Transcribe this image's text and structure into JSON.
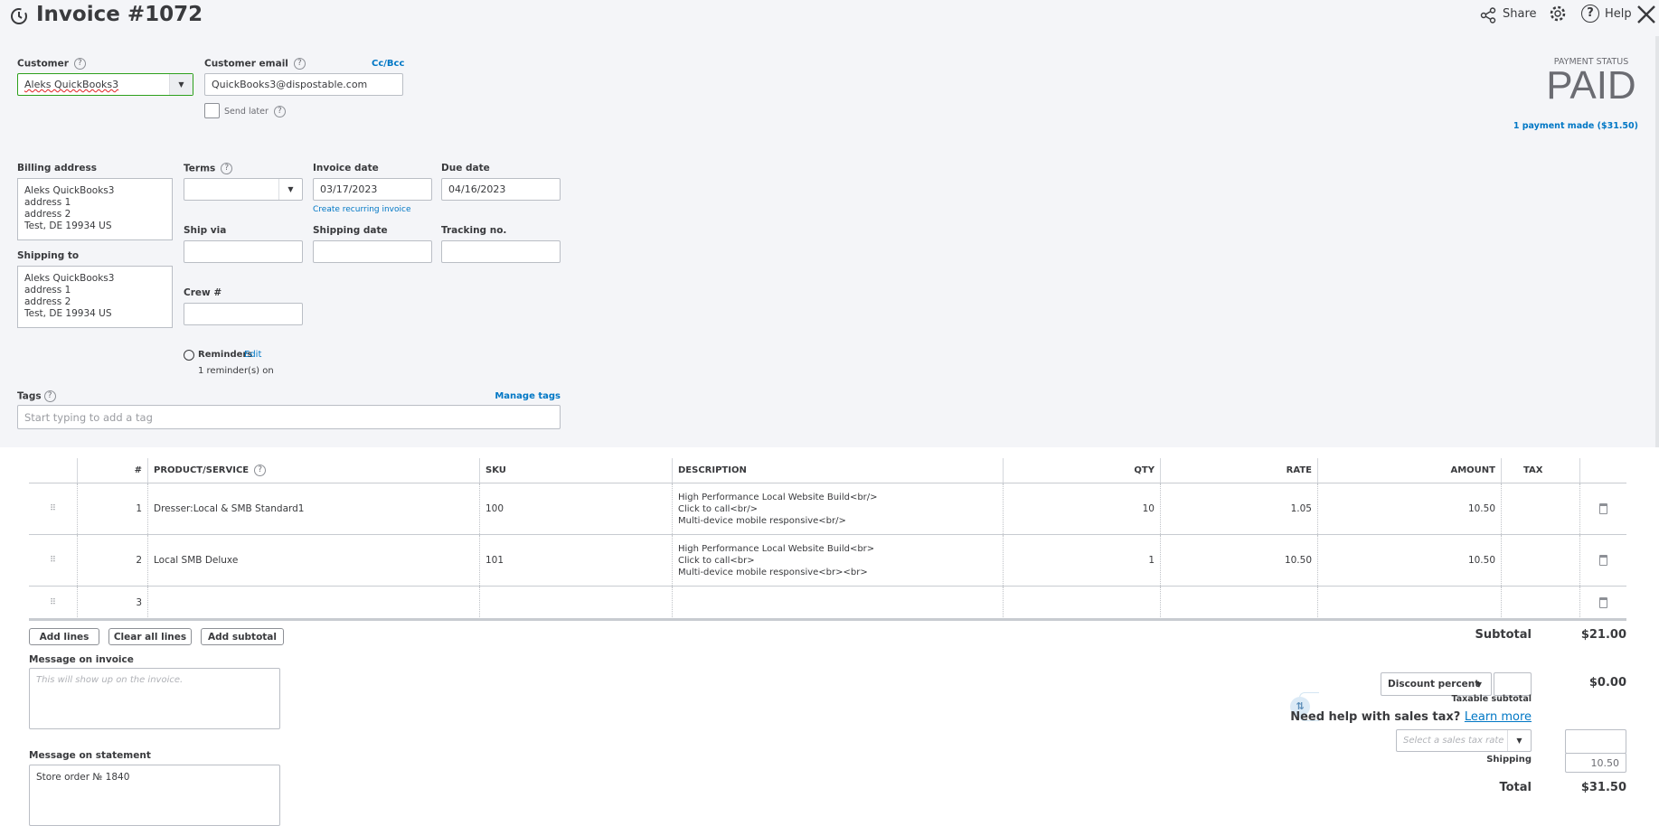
{
  "header": {
    "title": "Invoice #1072",
    "share": "Share",
    "help": "Help"
  },
  "customer": {
    "label": "Customer",
    "value": "Aleks QuickBooks3"
  },
  "email": {
    "label": "Customer email",
    "value": "QuickBooks3@dispostable.com",
    "cc_bcc": "Cc/Bcc",
    "send_later": "Send later"
  },
  "payment": {
    "label": "PAYMENT STATUS",
    "status": "PAID",
    "made": "1 payment made ($31.50)"
  },
  "billing": {
    "label": "Billing address",
    "lines": [
      "Aleks QuickBooks3",
      "address 1",
      "address 2",
      "Test, DE  19934 US"
    ]
  },
  "shipping_to": {
    "label": "Shipping to",
    "lines": [
      "Aleks QuickBooks3",
      "address 1",
      "address 2",
      "Test, DE  19934 US"
    ]
  },
  "terms": {
    "label": "Terms",
    "value": ""
  },
  "invoice_date": {
    "label": "Invoice date",
    "value": "03/17/2023",
    "recurring": "Create recurring invoice"
  },
  "due_date": {
    "label": "Due date",
    "value": "04/16/2023"
  },
  "ship_via": {
    "label": "Ship via"
  },
  "shipping_date": {
    "label": "Shipping date"
  },
  "tracking": {
    "label": "Tracking no."
  },
  "crew": {
    "label": "Crew #"
  },
  "reminders": {
    "label": "Reminders",
    "edit": "Edit",
    "status": "1 reminder(s) on"
  },
  "tags": {
    "label": "Tags",
    "manage": "Manage tags",
    "placeholder": "Start typing to add a tag"
  },
  "table": {
    "headers": [
      "#",
      "PRODUCT/SERVICE",
      "SKU",
      "DESCRIPTION",
      "QTY",
      "RATE",
      "AMOUNT",
      "TAX"
    ],
    "rows": [
      {
        "num": "1",
        "product": "Dresser:Local & SMB Standard1",
        "sku": "100",
        "description": [
          "High Performance Local Website Build<br/>",
          "Click to call<br/>",
          "Multi-device mobile responsive<br/>"
        ],
        "qty": "10",
        "rate": "1.05",
        "amount": "10.50",
        "tax": ""
      },
      {
        "num": "2",
        "product": "Local SMB Deluxe",
        "sku": "101",
        "description": [
          "High Performance Local Website Build<br>",
          "Click to call<br>",
          "Multi-device mobile responsive<br><br>"
        ],
        "qty": "1",
        "rate": "10.50",
        "amount": "10.50",
        "tax": ""
      },
      {
        "num": "3",
        "product": "",
        "sku": "",
        "description": [
          "",
          "",
          ""
        ],
        "qty": "",
        "rate": "",
        "amount": "",
        "tax": ""
      }
    ]
  },
  "buttons": {
    "add_lines": "Add lines",
    "clear_all": "Clear all lines",
    "add_subtotal": "Add subtotal"
  },
  "message_invoice": {
    "label": "Message on invoice",
    "placeholder": "This will show up on the invoice."
  },
  "message_statement": {
    "label": "Message on statement",
    "value": "Store order № 1840"
  },
  "totals": {
    "subtotal_label": "Subtotal",
    "subtotal": "$21.00",
    "discount_type": "Discount percent",
    "discount_value": "",
    "discount_amount": "$0.00",
    "taxable_subtotal": "Taxable subtotal",
    "sales_tax_help": "Need help with sales tax?",
    "learn_more": "Learn more",
    "tax_rate_placeholder": "Select a sales tax rate",
    "shipping_label": "Shipping",
    "shipping": "10.50",
    "total_label": "Total",
    "total": "$31.50"
  },
  "colors": {
    "accent": "#0077c5",
    "focus": "#2ca01c",
    "background": "#f4f5f8"
  }
}
